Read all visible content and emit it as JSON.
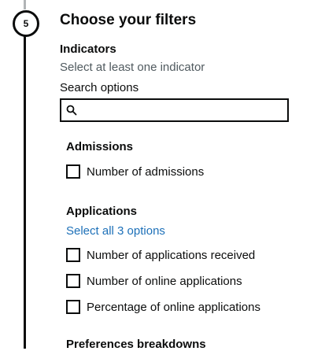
{
  "step": {
    "number": "5"
  },
  "section": {
    "title": "Choose your filters"
  },
  "indicators": {
    "label": "Indicators",
    "hint": "Select at least one indicator",
    "search_label": "Search options",
    "search_value": "",
    "search_placeholder": ""
  },
  "groups": [
    {
      "heading": "Admissions",
      "options": [
        {
          "label": "Number of admissions",
          "checked": false
        }
      ]
    },
    {
      "heading": "Applications",
      "select_all": "Select all 3 options",
      "options": [
        {
          "label": "Number of applications received",
          "checked": false
        },
        {
          "label": "Number of online applications",
          "checked": false
        },
        {
          "label": "Percentage of online applications",
          "checked": false
        }
      ]
    },
    {
      "heading": "Preferences breakdowns"
    }
  ],
  "colors": {
    "text": "#0b0c0c",
    "hint": "#505a5f",
    "link": "#1d70b8",
    "timeline_inactive": "#b1b4b6"
  }
}
